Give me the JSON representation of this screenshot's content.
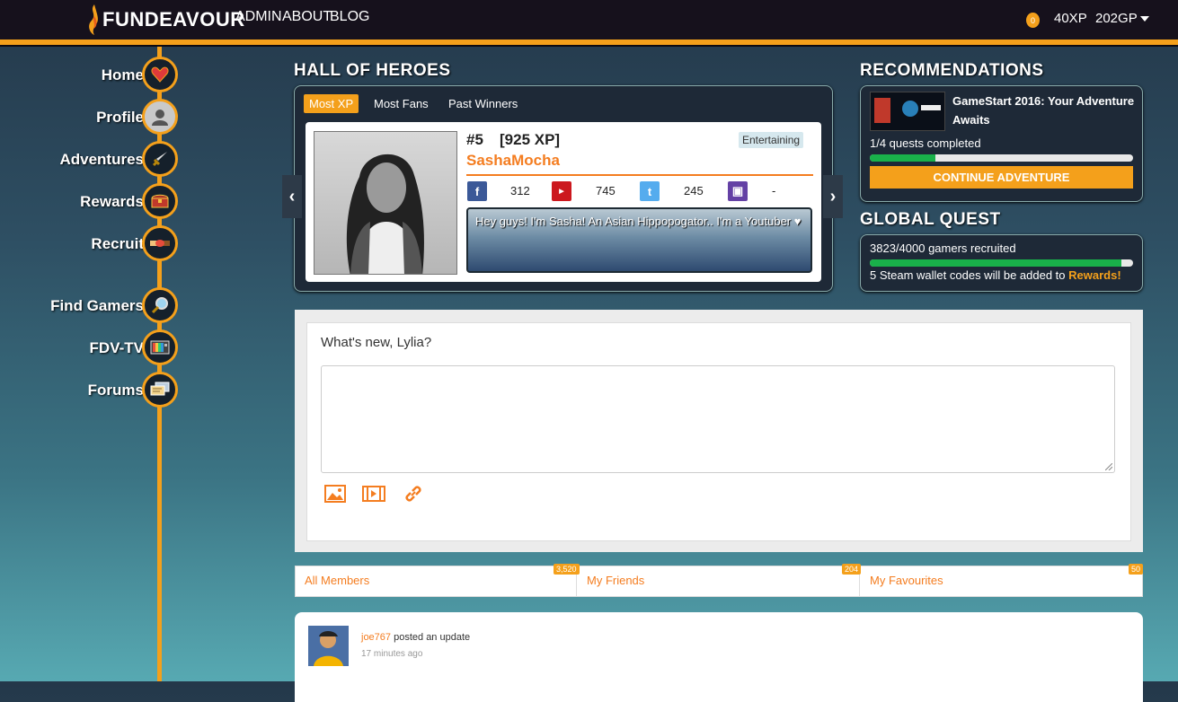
{
  "header": {
    "logo_text": "FUNDEAVOUR",
    "nav": [
      "ADMIN",
      "ABOUT",
      "BLOG"
    ],
    "coins": "0",
    "xp": "40XP",
    "gp": "202GP"
  },
  "sidebar": {
    "items": [
      {
        "label": "Home",
        "icon": "heart-icon"
      },
      {
        "label": "Profile",
        "icon": "avatar-icon"
      },
      {
        "label": "Adventures",
        "icon": "sword-icon"
      },
      {
        "label": "Rewards",
        "icon": "treasure-chest-icon"
      },
      {
        "label": "Recruit",
        "icon": "handshake-icon"
      },
      {
        "label": "Find Gamers",
        "icon": "magnifier-icon"
      },
      {
        "label": "FDV-TV",
        "icon": "tv-icon"
      },
      {
        "label": "Forums",
        "icon": "chat-icon"
      }
    ]
  },
  "hall": {
    "title": "HALL OF HEROES",
    "tabs": [
      "Most XP",
      "Most Fans",
      "Past Winners"
    ],
    "hero": {
      "rank": "#5",
      "xp": "[925 XP]",
      "name": "SashaMocha",
      "tag": "Entertaining",
      "facebook": "312",
      "youtube": "745",
      "twitter": "245",
      "twitch": "-",
      "bio": "Hey guys! I'm Sasha! An Asian Hippopogator.. I'm a Youtuber ♥"
    }
  },
  "recommendations": {
    "title": "RECOMMENDATIONS",
    "adventure_title": "GameStart 2016: Your Adventure Awaits",
    "progress_text": "1/4 quests completed",
    "progress": 0.25,
    "cta": "CONTINUE ADVENTURE"
  },
  "global_quest": {
    "title": "GLOBAL QUEST",
    "progress_text": "3823/4000 gamers recruited",
    "progress": 0.956,
    "reward_prefix": "5 Steam wallet codes will be added to",
    "reward_link": "Rewards!"
  },
  "post": {
    "prompt": "What's new, Lylia?",
    "tools": [
      "image-icon",
      "video-icon",
      "link-icon"
    ]
  },
  "filters": [
    {
      "label": "All Members",
      "count": "3,520"
    },
    {
      "label": "My Friends",
      "count": "204"
    },
    {
      "label": "My Favourites",
      "count": "50"
    }
  ],
  "activity": {
    "user": "joe767",
    "action": "posted an update",
    "time": "17 minutes ago"
  },
  "colors": {
    "accent": "#f4a01b",
    "link": "#f47d20",
    "progress": "#19b14a"
  }
}
